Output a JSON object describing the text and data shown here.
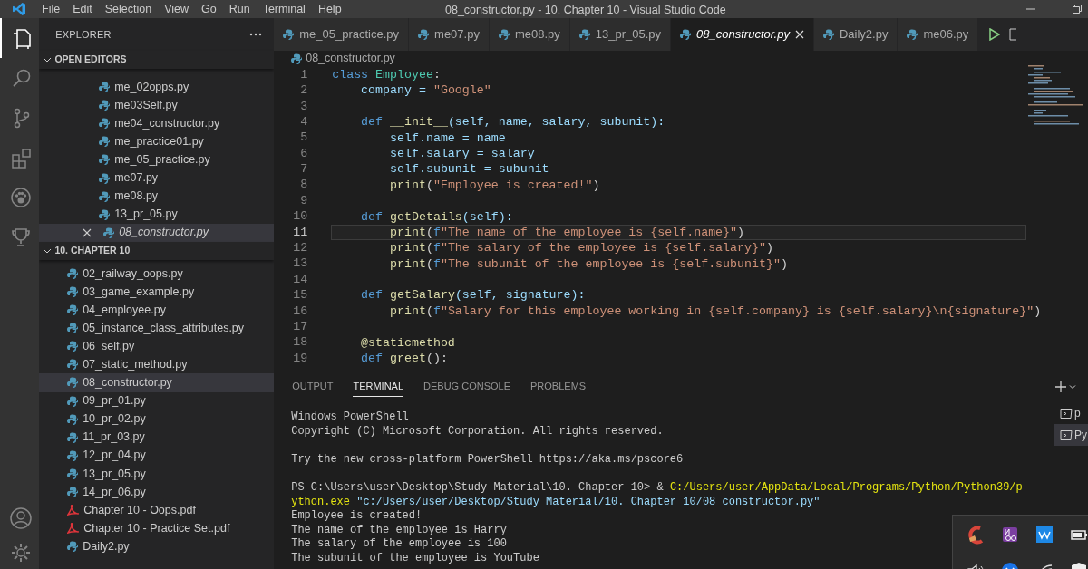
{
  "title_bar": {
    "menu": [
      "File",
      "Edit",
      "Selection",
      "View",
      "Go",
      "Run",
      "Terminal",
      "Help"
    ],
    "title": "08_constructor.py - 10. Chapter 10 - Visual Studio Code"
  },
  "activity_bar": [
    {
      "kind": "files",
      "selected": true
    },
    {
      "kind": "search",
      "selected": false
    },
    {
      "kind": "source-control",
      "selected": false
    },
    {
      "kind": "extensions",
      "selected": false
    },
    {
      "kind": "paw",
      "selected": false
    },
    {
      "kind": "trophy",
      "selected": false
    },
    {
      "kind": "account",
      "selected": false
    },
    {
      "kind": "gear",
      "selected": false
    }
  ],
  "sidebar": {
    "title": "EXPLORER",
    "sections": [
      {
        "title": "OPEN EDITORS",
        "expanded": true,
        "items": [
          {
            "name": "me_02opps.py",
            "kind": "py",
            "selected": false
          },
          {
            "name": "me03Self.py",
            "kind": "py",
            "selected": false
          },
          {
            "name": "me04_constructor.py",
            "kind": "py",
            "selected": false
          },
          {
            "name": "me_practice01.py",
            "kind": "py",
            "selected": false
          },
          {
            "name": "me_05_practice.py",
            "kind": "py",
            "selected": false
          },
          {
            "name": "me07.py",
            "kind": "py",
            "selected": false
          },
          {
            "name": "me08.py",
            "kind": "py",
            "selected": false
          },
          {
            "name": "13_pr_05.py",
            "kind": "py",
            "selected": false
          },
          {
            "name": "08_constructor.py",
            "kind": "py",
            "selected": true
          }
        ]
      },
      {
        "title": "10. CHAPTER 10",
        "expanded": true,
        "items": [
          {
            "name": "02_railway_oops.py",
            "kind": "py",
            "selected": false
          },
          {
            "name": "03_game_example.py",
            "kind": "py",
            "selected": false
          },
          {
            "name": "04_employee.py",
            "kind": "py",
            "selected": false
          },
          {
            "name": "05_instance_class_attributes.py",
            "kind": "py",
            "selected": false
          },
          {
            "name": "06_self.py",
            "kind": "py",
            "selected": false
          },
          {
            "name": "07_static_method.py",
            "kind": "py",
            "selected": false
          },
          {
            "name": "08_constructor.py",
            "kind": "py",
            "selected": true
          },
          {
            "name": "09_pr_01.py",
            "kind": "py",
            "selected": false
          },
          {
            "name": "10_pr_02.py",
            "kind": "py",
            "selected": false
          },
          {
            "name": "11_pr_03.py",
            "kind": "py",
            "selected": false
          },
          {
            "name": "12_pr_04.py",
            "kind": "py",
            "selected": false
          },
          {
            "name": "13_pr_05.py",
            "kind": "py",
            "selected": false
          },
          {
            "name": "14_pr_06.py",
            "kind": "py",
            "selected": false
          },
          {
            "name": "Chapter 10 - Oops.pdf",
            "kind": "pdf",
            "selected": false
          },
          {
            "name": "Chapter 10 - Practice Set.pdf",
            "kind": "pdf",
            "selected": false
          },
          {
            "name": "Daily2.py",
            "kind": "py",
            "selected": false
          }
        ]
      }
    ]
  },
  "tabs": [
    {
      "label": "me_05_practice.py",
      "selected": false
    },
    {
      "label": "me07.py",
      "selected": false
    },
    {
      "label": "me08.py",
      "selected": false
    },
    {
      "label": "13_pr_05.py",
      "selected": false
    },
    {
      "label": "08_constructor.py",
      "selected": true
    },
    {
      "label": "Daily2.py",
      "selected": false
    },
    {
      "label": "me06.py",
      "selected": false
    }
  ],
  "breadcrumb": "08_constructor.py",
  "code": {
    "lines": [
      {
        "number": "1",
        "current": false,
        "tokens": [
          {
            "text": "class ",
            "kind": "kw"
          },
          {
            "text": "Employee",
            "kind": "cls"
          },
          {
            "text": ":",
            "kind": "plain"
          }
        ]
      },
      {
        "number": "2",
        "current": false,
        "tokens": [
          {
            "text": "    company = ",
            "kind": "var"
          },
          {
            "text": "\"Google\"",
            "kind": "str"
          }
        ]
      },
      {
        "number": "3",
        "current": false
      },
      {
        "number": "4",
        "current": false,
        "tokens": [
          {
            "text": "    def ",
            "kind": "kw"
          },
          {
            "text": "__init__",
            "kind": "fn"
          },
          {
            "text": "(self, name, salary, subunit):",
            "kind": "var"
          }
        ]
      },
      {
        "number": "5",
        "current": false,
        "tokens": [
          {
            "text": "        self.name = name",
            "kind": "var"
          }
        ]
      },
      {
        "number": "6",
        "current": false,
        "tokens": [
          {
            "text": "        self.salary = salary",
            "kind": "var"
          }
        ]
      },
      {
        "number": "7",
        "current": false,
        "tokens": [
          {
            "text": "        self.subunit = subunit",
            "kind": "var"
          }
        ]
      },
      {
        "number": "8",
        "current": false,
        "tokens": [
          {
            "text": "        print",
            "kind": "fn"
          },
          {
            "text": "(",
            "kind": "plain"
          },
          {
            "text": "\"Employee is created!\"",
            "kind": "str"
          },
          {
            "text": ")",
            "kind": "plain"
          }
        ]
      },
      {
        "number": "9",
        "current": false
      },
      {
        "number": "10",
        "current": false,
        "tokens": [
          {
            "text": "    def ",
            "kind": "kw"
          },
          {
            "text": "getDetails",
            "kind": "fn"
          },
          {
            "text": "(self):",
            "kind": "var"
          }
        ]
      },
      {
        "number": "11",
        "current": true,
        "tokens": [
          {
            "text": "        print",
            "kind": "fn"
          },
          {
            "text": "(",
            "kind": "plain"
          },
          {
            "text": "f",
            "kind": "kw"
          },
          {
            "text": "\"The name of the employee is {self.name}\"",
            "kind": "str"
          },
          {
            "text": ")",
            "kind": "plain"
          }
        ]
      },
      {
        "number": "12",
        "current": false,
        "tokens": [
          {
            "text": "        print",
            "kind": "fn"
          },
          {
            "text": "(",
            "kind": "plain"
          },
          {
            "text": "f",
            "kind": "kw"
          },
          {
            "text": "\"The salary of the employee is {self.salary}\"",
            "kind": "str"
          },
          {
            "text": ")",
            "kind": "plain"
          }
        ]
      },
      {
        "number": "13",
        "current": false,
        "tokens": [
          {
            "text": "        print",
            "kind": "fn"
          },
          {
            "text": "(",
            "kind": "plain"
          },
          {
            "text": "f",
            "kind": "kw"
          },
          {
            "text": "\"The subunit of the employee is {self.subunit}\"",
            "kind": "str"
          },
          {
            "text": ")",
            "kind": "plain"
          }
        ]
      },
      {
        "number": "14",
        "current": false
      },
      {
        "number": "15",
        "current": false,
        "tokens": [
          {
            "text": "    def ",
            "kind": "kw"
          },
          {
            "text": "getSalary",
            "kind": "fn"
          },
          {
            "text": "(self, signature):",
            "kind": "var"
          }
        ]
      },
      {
        "number": "16",
        "current": false,
        "tokens": [
          {
            "text": "        print",
            "kind": "fn"
          },
          {
            "text": "(",
            "kind": "plain"
          },
          {
            "text": "f",
            "kind": "kw"
          },
          {
            "text": "\"Salary for this employee working in {self.company} is {self.salary}\\n{signature}\"",
            "kind": "str"
          },
          {
            "text": ")",
            "kind": "plain"
          }
        ]
      },
      {
        "number": "17",
        "current": false
      },
      {
        "number": "18",
        "current": false,
        "tokens": [
          {
            "text": "    @staticmethod",
            "kind": "fn"
          }
        ]
      },
      {
        "number": "19",
        "current": false,
        "tokens": [
          {
            "text": "    def ",
            "kind": "kw"
          },
          {
            "text": "greet",
            "kind": "fn"
          },
          {
            "text": "():",
            "kind": "plain"
          }
        ]
      }
    ]
  },
  "panel": {
    "tabs": [
      {
        "label": "OUTPUT",
        "selected": false
      },
      {
        "label": "TERMINAL",
        "selected": true
      },
      {
        "label": "DEBUG CONSOLE",
        "selected": false
      },
      {
        "label": "PROBLEMS",
        "selected": false
      }
    ],
    "terminal": [
      [
        [
          {
            "text": "Windows PowerShell",
            "kind": "plain"
          }
        ],
        [
          {
            "text": "Copyright (C) Microsoft Corporation. All rights reserved.",
            "kind": "plain"
          }
        ]
      ],
      [
        [
          {
            "text": "Try the new cross-platform PowerShell https://aka.ms/pscore6",
            "kind": "plain"
          }
        ]
      ],
      [
        [
          {
            "text": "PS C:\\Users\\user\\Desktop\\Study Material\\10. Chapter 10> & ",
            "kind": "plain"
          },
          {
            "text": "C:/Users/user/AppData/Local/Programs/Python/Python39/p",
            "kind": "path"
          }
        ],
        [
          {
            "text": "ython.exe",
            "kind": "path"
          },
          {
            "text": " \"c:/Users/user/Desktop/Study Material/10. Chapter 10/08_constructor.py\"",
            "kind": "arg"
          }
        ],
        [
          {
            "text": "Employee is created!",
            "kind": "plain"
          }
        ],
        [
          {
            "text": "The name of the employee is Harry",
            "kind": "plain"
          }
        ],
        [
          {
            "text": "The salary of the employee is 100",
            "kind": "plain"
          }
        ],
        [
          {
            "text": "The subunit of the employee is YouTube",
            "kind": "plain"
          }
        ]
      ]
    ],
    "terminal_list": [
      {
        "label": "p",
        "selected": false
      },
      {
        "label": "Py",
        "selected": true
      }
    ]
  }
}
